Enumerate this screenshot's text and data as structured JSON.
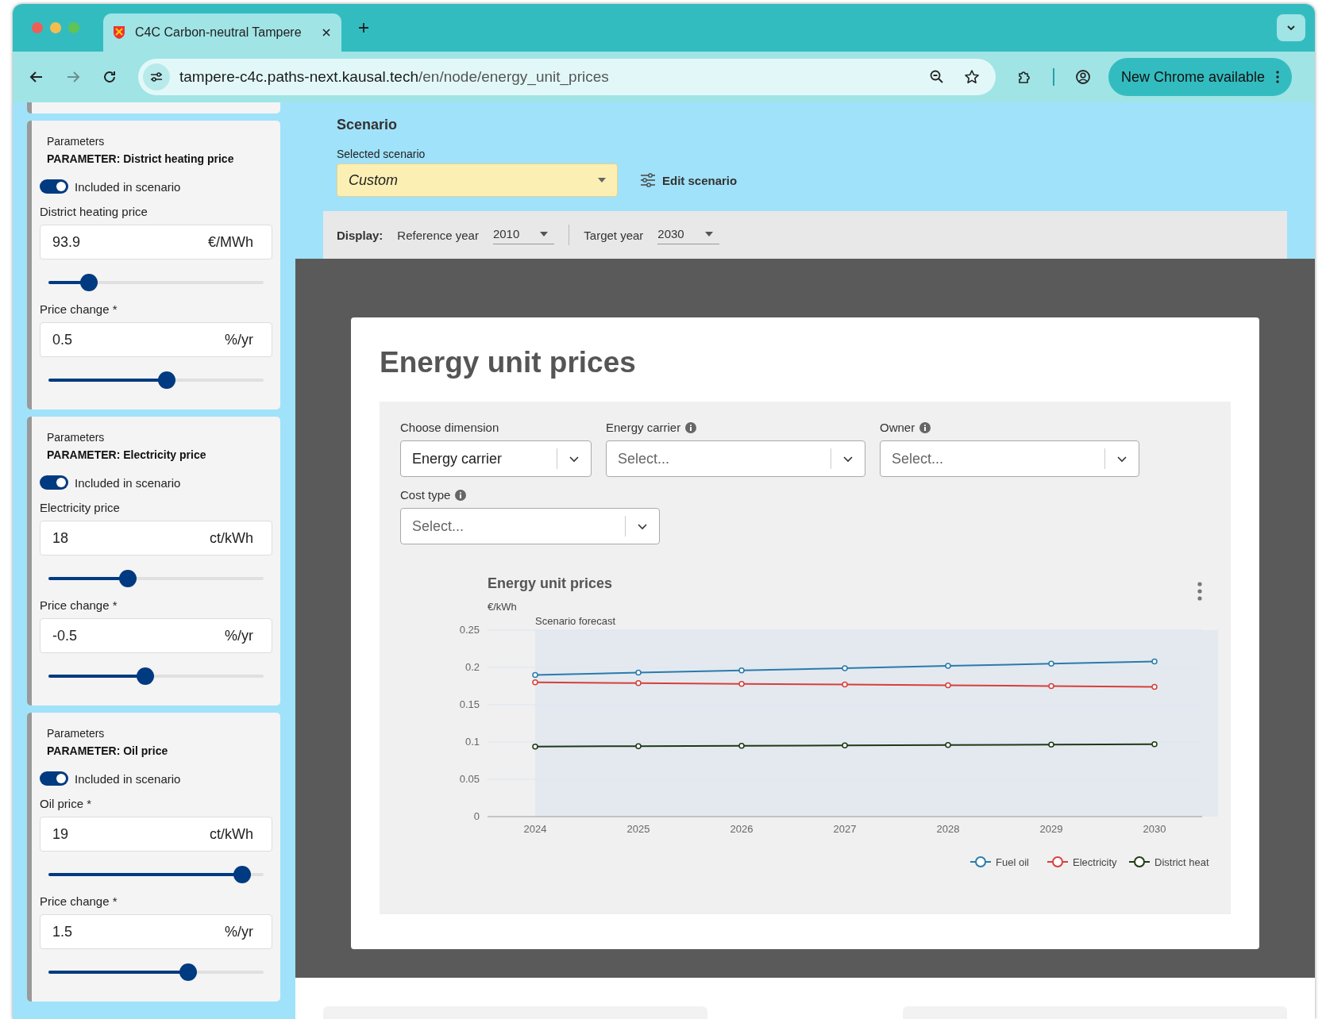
{
  "browser": {
    "tab_title": "C4C Carbon-neutral Tampere",
    "url_host": "tampere-c4c.paths-next.kausal.tech",
    "url_path": "/en/node/energy_unit_prices",
    "update_button": "New Chrome available"
  },
  "sidebar": {
    "panels": [
      {
        "section": "Parameters",
        "title": "PARAMETER: District heating price",
        "included": true,
        "include_label": "Included in scenario",
        "fields": [
          {
            "label": "District heating price",
            "value": "93.9",
            "unit": "€/MWh",
            "level": 0.19
          },
          {
            "label": "Price change *",
            "value": "0.5",
            "unit": "%/yr",
            "level": 0.55
          }
        ]
      },
      {
        "section": "Parameters",
        "title": "PARAMETER: Electricity price",
        "included": true,
        "include_label": "Included in scenario",
        "fields": [
          {
            "label": "Electricity price",
            "value": "18",
            "unit": "ct/kWh",
            "level": 0.37
          },
          {
            "label": "Price change *",
            "value": "-0.5",
            "unit": "%/yr",
            "level": 0.45
          }
        ]
      },
      {
        "section": "Parameters",
        "title": "PARAMETER: Oil price",
        "included": true,
        "include_label": "Included in scenario",
        "fields": [
          {
            "label": "Oil price *",
            "value": "19",
            "unit": "ct/kWh",
            "level": 0.9
          },
          {
            "label": "Price change *",
            "value": "1.5",
            "unit": "%/yr",
            "level": 0.65
          }
        ]
      }
    ]
  },
  "scenario": {
    "heading": "Scenario",
    "select_label": "Selected scenario",
    "selected": "Custom",
    "edit_button": "Edit scenario"
  },
  "display": {
    "label": "Display:",
    "reference_label": "Reference year",
    "reference_year": "2010",
    "target_label": "Target year",
    "target_year": "2030"
  },
  "card": {
    "title": "Energy unit prices",
    "filters": [
      {
        "label": "Choose dimension",
        "info": false,
        "value": "Energy carrier"
      },
      {
        "label": "Energy carrier",
        "info": true,
        "placeholder": "Select..."
      },
      {
        "label": "Owner",
        "info": true,
        "placeholder": "Select..."
      },
      {
        "label": "Cost type",
        "info": true,
        "placeholder": "Select..."
      }
    ],
    "chart_data": {
      "type": "line",
      "title": "Energy unit prices",
      "ylabel": "€/kWh",
      "categories": [
        "2024",
        "2025",
        "2026",
        "2027",
        "2028",
        "2029",
        "2030"
      ],
      "series": [
        {
          "name": "Fuel oil",
          "color": "#2a7bab",
          "marker": "circle",
          "values": [
            0.19,
            0.193,
            0.196,
            0.199,
            0.202,
            0.205,
            0.208
          ]
        },
        {
          "name": "Electricity",
          "color": "#d6403a",
          "marker": "circle",
          "values": [
            0.18,
            0.179,
            0.178,
            0.177,
            0.176,
            0.175,
            0.174
          ]
        },
        {
          "name": "District heat",
          "color": "#1e3a14",
          "marker": "circle",
          "values": [
            0.094,
            0.0945,
            0.095,
            0.0955,
            0.096,
            0.0965,
            0.097
          ]
        }
      ],
      "grid": true,
      "legend": true,
      "ylim": [
        0,
        0.25
      ],
      "yticks": [
        {
          "value": 0,
          "label": "0"
        },
        {
          "value": 0.05,
          "label": "0.05"
        },
        {
          "value": 0.1,
          "label": "0.1"
        },
        {
          "value": 0.15,
          "label": "0.15"
        },
        {
          "value": 0.2,
          "label": "0.2"
        },
        {
          "value": 0.25,
          "label": "0.25"
        }
      ],
      "annotations": [
        "Scenario forecast"
      ]
    }
  }
}
